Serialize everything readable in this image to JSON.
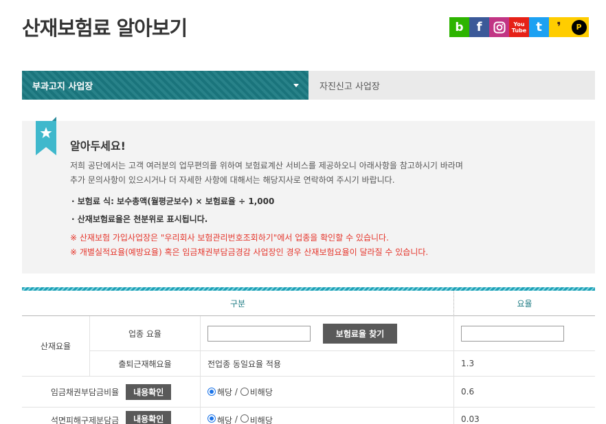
{
  "page": {
    "title": "산재보험료 알아보기"
  },
  "sns": {
    "blog": "b",
    "facebook": "f",
    "youtube_top": "You",
    "youtube_bottom": "Tube",
    "twitter": "t",
    "kakaostory": "❜",
    "post": "P"
  },
  "tabs": {
    "active": "부과고지 사업장",
    "inactive": "자진신고 사업장"
  },
  "notice": {
    "heading": "알아두세요!",
    "desc_line1": "저희 공단에서는 고객 여러분의 업무편의를 위하여 보험료계산 서비스를 제공하오니 아래사항을 참고하시기 바라며",
    "desc_line2": "추가 문의사항이 있으시거나 더 자세한 사항에 대해서는 해당지사로 연락하여 주시기 바랍니다.",
    "rule1": "· 보험료 식: 보수총액(월평균보수) × 보험료율 ÷ 1,000",
    "rule2": "· 산재보험료율은 천분위로 표시됩니다.",
    "warn1": "※ 산재보험 가입사업장은 \"우리회사 보험관리번호조회하기\"에서 업종을 확인할 수 있습니다.",
    "warn2": "※ 개별실적요율(예방요율) 혹은 임금채권부담금경감 사업장인 경우 산재보험요율이 달라질 수 있습니다."
  },
  "table": {
    "head_gubun": "구분",
    "head_rate": "요율",
    "group_label": "산재요율",
    "row1": {
      "label": "업종 요율",
      "button": "보험료율 찾기",
      "input_value": "",
      "rate_value": ""
    },
    "row2": {
      "label": "출퇴근재해요율",
      "desc": "전업종 동일요율 적용",
      "rate": "1.3"
    },
    "row3": {
      "label": "임금채권부담금비율",
      "button": "내용확인",
      "yes": "해당",
      "sep": " / ",
      "no": "비해당",
      "rate": "0.6"
    },
    "row4": {
      "label": "석면피해구제분담금",
      "button": "내용확인",
      "yes": "해당",
      "sep": " / ",
      "no": "비해당",
      "rate": "0.03"
    }
  },
  "colors": {
    "teal": "#1b7a82",
    "warn": "#e5352b",
    "bookmark": "#3fb8cc"
  }
}
